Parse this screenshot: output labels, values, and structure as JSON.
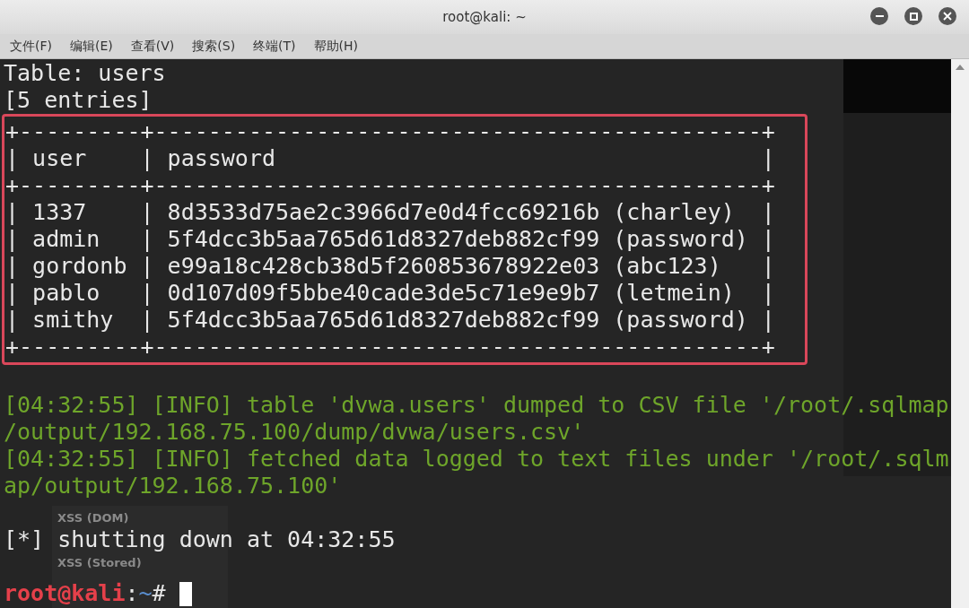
{
  "window": {
    "title": "root@kali: ~"
  },
  "menu": [
    "文件(F)",
    "编辑(E)",
    "查看(V)",
    "搜索(S)",
    "终端(T)",
    "帮助(H)"
  ],
  "background_menu": [
    "XSS (DOM)",
    "XSS (Stored)"
  ],
  "output": [
    {
      "kind": "plain",
      "text": "Table: users"
    },
    {
      "kind": "plain",
      "text": "[5 entries]"
    },
    {
      "kind": "table",
      "highlighted": true,
      "lines": [
        "+---------+---------------------------------------------+",
        "| user    | password                                    |",
        "+---------+---------------------------------------------+",
        "| 1337    | 8d3533d75ae2c3966d7e0d4fcc69216b (charley)  |",
        "| admin   | 5f4dcc3b5aa765d61d8327deb882cf99 (password) |",
        "| gordonb | e99a18c428cb38d5f260853678922e03 (abc123)   |",
        "| pablo   | 0d107d09f5bbe40cade3de5c71e9e9b7 (letmein)  |",
        "| smithy  | 5f4dcc3b5aa765d61d8327deb882cf99 (password) |",
        "+---------+---------------------------------------------+"
      ]
    },
    {
      "kind": "blank"
    },
    {
      "kind": "info",
      "text": "[04:32:55] [INFO] table 'dvwa.users' dumped to CSV file '/root/.sqlmap"
    },
    {
      "kind": "info",
      "text": "/output/192.168.75.100/dump/dvwa/users.csv'"
    },
    {
      "kind": "info",
      "text": "[04:32:55] [INFO] fetched data logged to text files under '/root/.sqlm"
    },
    {
      "kind": "info",
      "text": "ap/output/192.168.75.100'"
    },
    {
      "kind": "blank"
    },
    {
      "kind": "plain",
      "text": "[*] shutting down at 04:32:55"
    },
    {
      "kind": "blank"
    },
    {
      "kind": "prompt",
      "user_host": "root@kali",
      "separator": ":",
      "path": "~",
      "symbol": "#"
    }
  ]
}
